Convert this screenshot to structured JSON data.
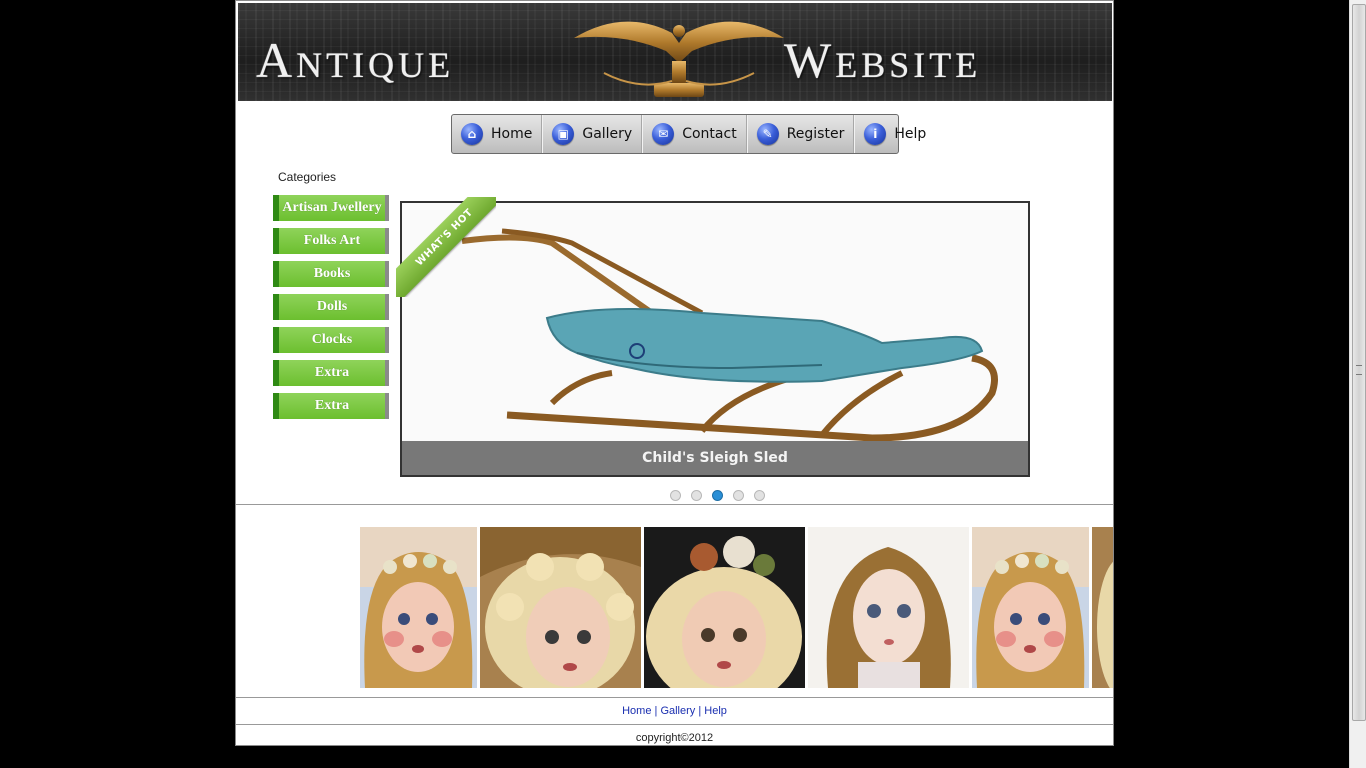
{
  "header": {
    "title_word1_initial": "A",
    "title_word1_rest": "NTIQUE",
    "title_word2_initial": "W",
    "title_word2_rest": "EBSITE"
  },
  "nav": {
    "items": [
      {
        "label": "Home",
        "icon": "home-icon"
      },
      {
        "label": "Gallery",
        "icon": "gallery-icon"
      },
      {
        "label": "Contact",
        "icon": "contact-icon"
      },
      {
        "label": "Register",
        "icon": "register-icon"
      },
      {
        "label": "Help",
        "icon": "info-icon"
      }
    ]
  },
  "categories": {
    "title": "Categories",
    "items": [
      "Artisan Jwellery",
      "Folks Art",
      "Books",
      "Dolls",
      "Clocks",
      "Extra",
      "Extra"
    ]
  },
  "slider": {
    "ribbon": "WHAT'S HOT",
    "caption": "Child's Sleigh Sled",
    "dots": 5,
    "active_dot": 3
  },
  "footer": {
    "links": [
      "Home",
      "Gallery",
      "Help"
    ],
    "separator": "|",
    "copyright": "copyright©2012"
  },
  "colors": {
    "category_green": "#6cbf2f",
    "link_blue": "#1a2fb0",
    "dot_active": "#2a8fd6"
  }
}
